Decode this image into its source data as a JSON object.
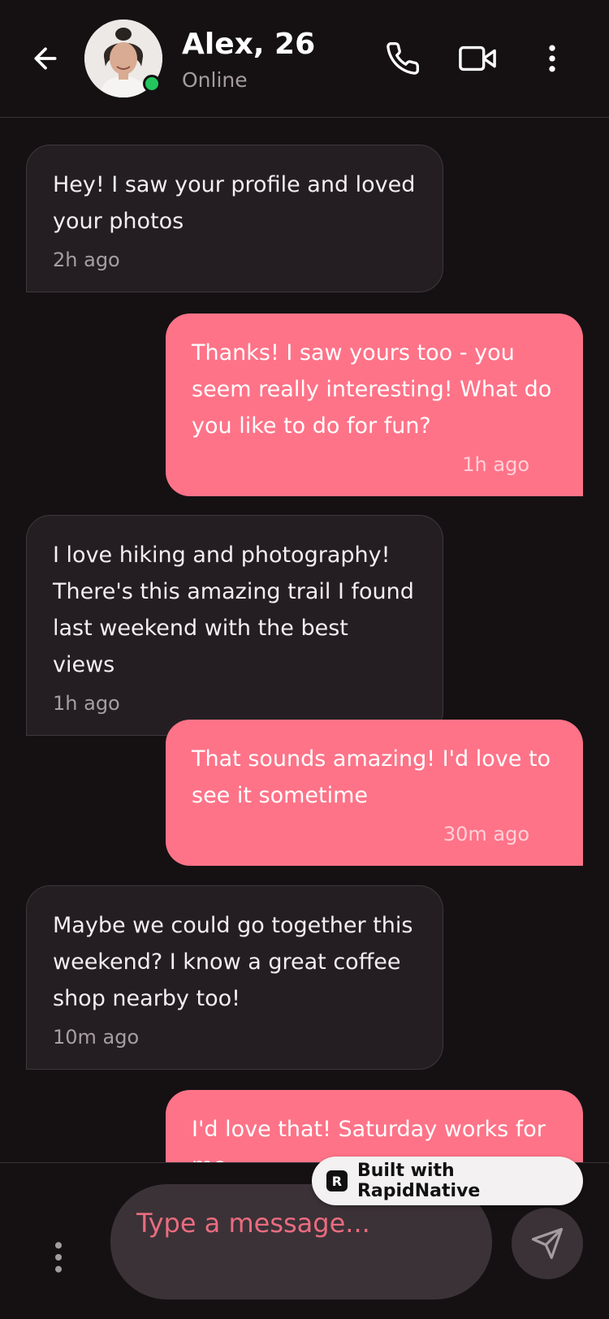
{
  "header": {
    "name": "Alex, 26",
    "status": "Online",
    "icons": {
      "back": "arrow-left-icon",
      "call": "phone-icon",
      "video": "video-camera-icon",
      "more": "more-vertical-icon"
    }
  },
  "messages": [
    {
      "direction": "in",
      "text": "Hey! I saw your profile and loved\nyour photos",
      "time": "2h ago"
    },
    {
      "direction": "out",
      "text": "Thanks! I saw yours too - you\nseem really interesting! What do\nyou like to do for fun?",
      "time": "1h ago"
    },
    {
      "direction": "in",
      "text": "I love hiking and photography!\nThere's this amazing trail I found\nlast weekend with the best views",
      "time": "1h ago"
    },
    {
      "direction": "out",
      "text": "That sounds amazing! I'd love to\nsee it sometime",
      "time": "30m ago"
    },
    {
      "direction": "in",
      "text": "Maybe we could go together this\nweekend? I know a great coffee\nshop nearby too!",
      "time": "10m ago"
    },
    {
      "direction": "out",
      "text": "I'd love that! Saturday works for\nme",
      "time": ""
    }
  ],
  "composer": {
    "placeholder": "Type a message...",
    "icons": {
      "attach": "more-vertical-icon",
      "send": "send-icon"
    }
  },
  "badge": {
    "label": "Built with RapidNative",
    "logo_letter": "R"
  },
  "colors": {
    "accent": "#fe7388",
    "background": "#151113",
    "incoming_bubble": "#241e22",
    "online": "#22c55e"
  }
}
